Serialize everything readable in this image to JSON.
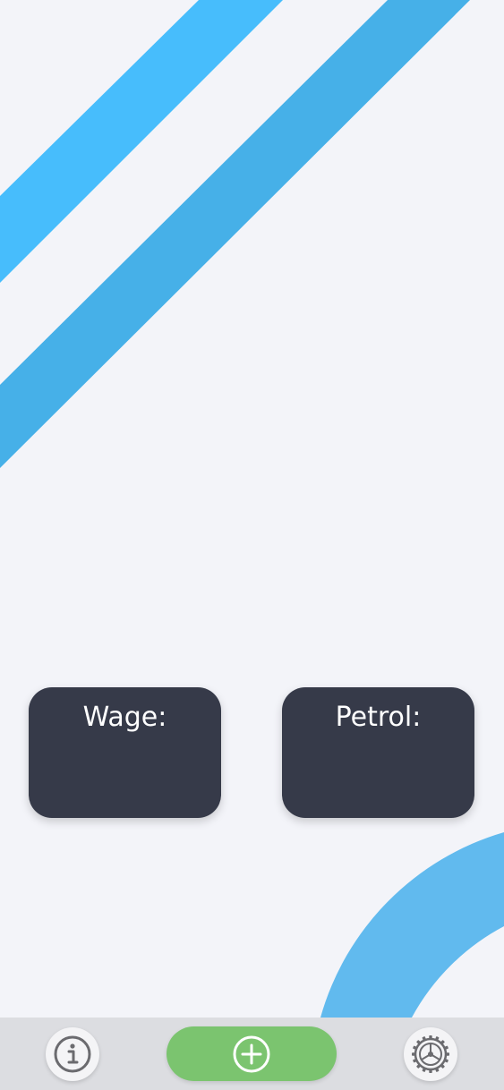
{
  "colors": {
    "background": "#f3f4f9",
    "stripe_light": "#47bdfc",
    "stripe_dark": "#46b0e8",
    "arc": "#61baee",
    "card": "#363a49",
    "card_text": "#ffffff",
    "bottom_bar": "#dcdde1",
    "add_button": "#7bc46f",
    "icon_gray": "#6b6b6f"
  },
  "cards": [
    {
      "label": "Wage:",
      "value": ""
    },
    {
      "label": "Petrol:",
      "value": ""
    }
  ],
  "bottom_bar": {
    "info_button": {
      "icon": "info-icon"
    },
    "add_button": {
      "icon": "plus-circle-icon"
    },
    "settings_button": {
      "icon": "gear-icon"
    }
  }
}
